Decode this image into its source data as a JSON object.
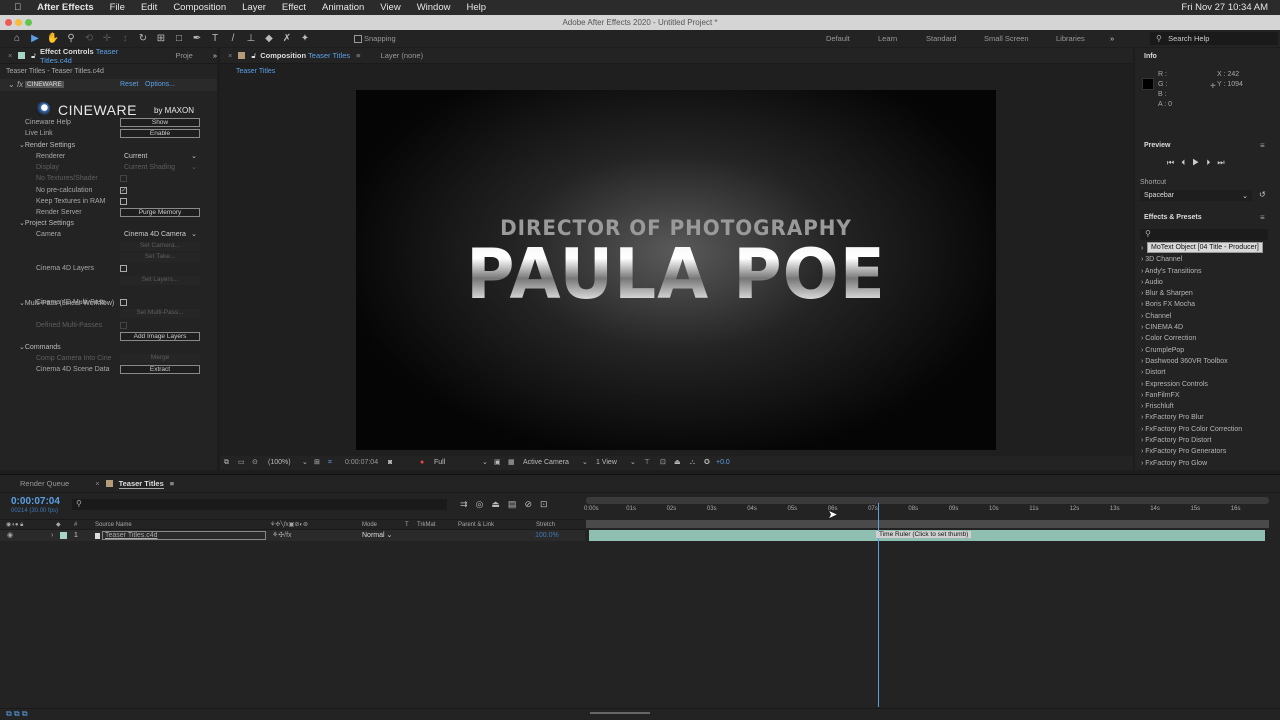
{
  "menubar": {
    "app": "After Effects",
    "items": [
      "File",
      "Edit",
      "Composition",
      "Layer",
      "Effect",
      "Animation",
      "View",
      "Window",
      "Help"
    ],
    "clock": "Fri Nov 27  10:34 AM"
  },
  "window_title": "Adobe After Effects 2020 - Untitled Project *",
  "toolbar": {
    "snapping": "Snapping",
    "workspaces": [
      "Default",
      "Learn",
      "Standard",
      "Small Screen",
      "Libraries"
    ],
    "search_placeholder": "Search Help"
  },
  "effect_controls": {
    "tab_label": "Effect Controls",
    "tab_target": "Teaser Titles.c4d",
    "other_tab": "Proje",
    "breadcrumb": "Teaser Titles - Teaser Titles.c4d",
    "effect_name": "CINEWARE",
    "reset": "Reset",
    "options": "Options...",
    "logo": "CINEWARE",
    "logo_by": "by MAXON",
    "rows": [
      {
        "label": "Cineware Help",
        "button": "Show"
      },
      {
        "label": "Live Link",
        "button": "Enable"
      },
      {
        "section": "Render Settings"
      },
      {
        "label": "Renderer",
        "select": "Current"
      },
      {
        "label": "Display",
        "select": "Current Shading",
        "disabled": true
      },
      {
        "label": "No Textures/Shader",
        "checkbox": false,
        "disabled": true
      },
      {
        "label": "No pre-calculation",
        "checkbox": true
      },
      {
        "label": "Keep Textures in RAM",
        "checkbox": false
      },
      {
        "label": "Render Server",
        "button": "Purge Memory"
      },
      {
        "section": "Project Settings"
      },
      {
        "label": "Camera",
        "select": "Cinema 4D Camera"
      },
      {
        "disabled_button": "Set Camera..."
      },
      {
        "disabled_button": "Set Take..."
      },
      {
        "label": "Cinema 4D Layers",
        "checkbox": false
      },
      {
        "disabled_button": "Set Layers..."
      },
      {
        "section": "Multi-Pass (Linear Workflow)"
      },
      {
        "label": "Cinema 4D Multi-Pass",
        "checkbox": false
      },
      {
        "disabled_button": "Set Multi-Pass..."
      },
      {
        "label": "Defined Multi-Passes",
        "checkbox": false,
        "disabled": true
      },
      {
        "button": "Add Image Layers"
      },
      {
        "section": "Commands"
      },
      {
        "label": "Comp Camera Into Cine",
        "disabled_button": "Merge",
        "disabled": true
      },
      {
        "label": "Cinema 4D Scene Data",
        "button": "Extract"
      }
    ]
  },
  "composition": {
    "tab_label": "Composition",
    "tab_target": "Teaser Titles",
    "layer_tab": "Layer (none)",
    "subtab": "Teaser Titles",
    "text_top": "DIRECTOR OF PHOTOGRAPHY",
    "text_main": "PAULA POE",
    "footer": {
      "zoom": "(100%)",
      "timecode": "0:00:07:04",
      "resolution": "Full",
      "camera": "Active Camera",
      "views": "1 View",
      "exposure": "+0.0"
    }
  },
  "info": {
    "title": "Info",
    "r": "R :",
    "g": "G :",
    "b": "B :",
    "a": "A : 0",
    "x": "X : 242",
    "y": "Y : 1094"
  },
  "preview": {
    "title": "Preview",
    "shortcut_label": "Shortcut",
    "shortcut": "Spacebar"
  },
  "effects_presets": {
    "title": "Effects & Presets",
    "tooltip": "MoText Object [04 Title - Producer]",
    "items": [
      "3D Channel",
      "Andy's Transitions",
      "Audio",
      "Blur & Sharpen",
      "Boris FX Mocha",
      "Channel",
      "CINEMA 4D",
      "Color Correction",
      "CrumplePop",
      "Dashwood 360VR Toolbox",
      "Distort",
      "Expression Controls",
      "FanFilmFX",
      "Frischluft",
      "FxFactory Pro Blur",
      "FxFactory Pro Color Correction",
      "FxFactory Pro Distort",
      "FxFactory Pro Generators",
      "FxFactory Pro Glow"
    ]
  },
  "timeline": {
    "tabs": {
      "render_queue": "Render Queue",
      "comp": "Teaser Titles"
    },
    "timecode": "0:00:07:04",
    "frame_info": "00214 (30.00 fps)",
    "columns": {
      "num": "#",
      "source": "Source Name",
      "mode": "Mode",
      "t": "T",
      "trkmat": "TrkMat",
      "parent": "Parent & Link",
      "stretch": "Stretch"
    },
    "layer": {
      "num": "1",
      "name": "Teaser Titles.c4d",
      "mode": "Normal",
      "stretch": "100.0%"
    },
    "ruler": [
      "0:00s",
      "01s",
      "02s",
      "03s",
      "04s",
      "05s",
      "06s",
      "07s",
      "08s",
      "09s",
      "10s",
      "11s",
      "12s",
      "13s",
      "14s",
      "15s",
      "16s"
    ],
    "playhead_seconds": 7.13,
    "duration_seconds": 16.8,
    "tooltip": "Time Ruler (Click to set thumb)"
  },
  "colors": {
    "accent": "#5aa0e6",
    "layer_bar": "#8fbfb0",
    "label": "#a6d4c6"
  }
}
